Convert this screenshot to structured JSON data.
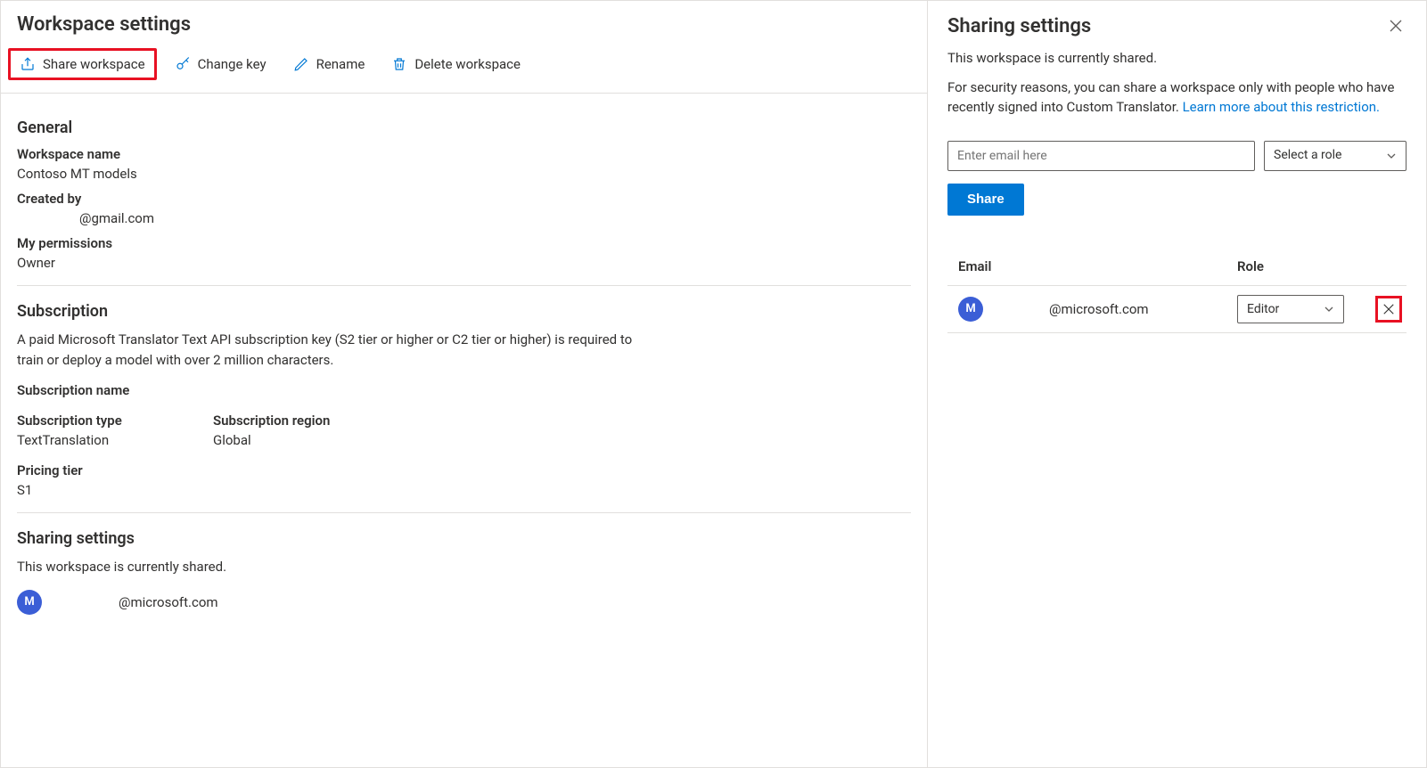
{
  "page": {
    "title": "Workspace settings"
  },
  "toolbar": {
    "share": "Share workspace",
    "change_key": "Change key",
    "rename": "Rename",
    "delete": "Delete workspace"
  },
  "general": {
    "header": "General",
    "workspace_name_label": "Workspace name",
    "workspace_name_value": "Contoso MT models",
    "created_by_label": "Created by",
    "created_by_value": "@gmail.com",
    "permissions_label": "My permissions",
    "permissions_value": "Owner"
  },
  "subscription": {
    "header": "Subscription",
    "desc": "A paid Microsoft Translator Text API subscription key (S2 tier or higher or C2 tier or higher) is required to train or deploy a model with over 2 million characters.",
    "name_label": "Subscription name",
    "name_value": "",
    "type_label": "Subscription type",
    "type_value": "TextTranslation",
    "region_label": "Subscription region",
    "region_value": "Global",
    "tier_label": "Pricing tier",
    "tier_value": "S1"
  },
  "sharing_left": {
    "header": "Sharing settings",
    "status": "This workspace is currently shared.",
    "user_initial": "M",
    "user_email": "@microsoft.com"
  },
  "panel": {
    "title": "Sharing settings",
    "status": "This workspace is currently shared.",
    "security_text": "For security reasons, you can share a workspace only with people who have recently signed into Custom Translator. ",
    "security_link": "Learn more about this restriction.",
    "email_placeholder": "Enter email here",
    "role_placeholder": "Select a role",
    "share_button": "Share",
    "table": {
      "email_header": "Email",
      "role_header": "Role",
      "rows": [
        {
          "initial": "M",
          "email": "@microsoft.com",
          "role": "Editor"
        }
      ]
    }
  }
}
